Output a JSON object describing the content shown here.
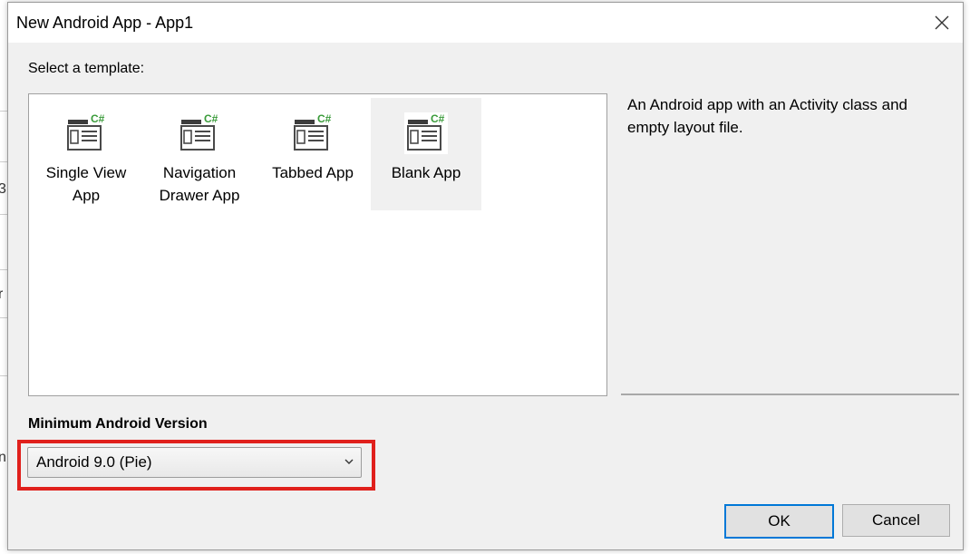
{
  "window": {
    "title": "New Android App - App1",
    "close_icon": "close-icon"
  },
  "template_section": {
    "label": "Select a template:",
    "templates": [
      {
        "line1": "Single View",
        "line2": "App",
        "icon": "csharp-template-icon",
        "selected": false
      },
      {
        "line1": "Navigation",
        "line2": "Drawer App",
        "icon": "csharp-template-icon",
        "selected": false
      },
      {
        "line1": "Tabbed App",
        "line2": "",
        "icon": "csharp-template-icon",
        "selected": false
      },
      {
        "line1": "Blank App",
        "line2": "",
        "icon": "csharp-template-icon",
        "selected": true
      }
    ],
    "description": "An Android app with an Activity class and empty layout file."
  },
  "min_version": {
    "label": "Minimum Android Version",
    "selected": "Android 9.0 (Pie)",
    "highlight_color": "#e0201c"
  },
  "buttons": {
    "ok": "OK",
    "cancel": "Cancel"
  },
  "background": {
    "char1": "3",
    "char2": "r",
    "char3": "n"
  },
  "colors": {
    "accent": "#0078d7",
    "csharp_green": "#3a9b3a"
  }
}
